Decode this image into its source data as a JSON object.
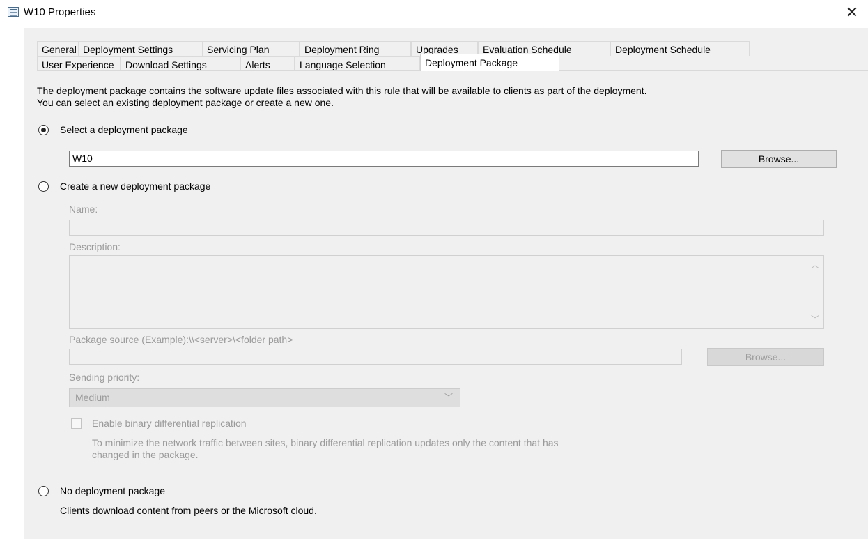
{
  "window": {
    "title": "W10 Properties",
    "close_glyph": "✕",
    "app_icon": "properties-window-icon"
  },
  "tabs_row1": [
    "General",
    "Deployment Settings",
    "Servicing Plan",
    "Deployment Ring",
    "Upgrades",
    "Evaluation Schedule",
    "Deployment Schedule"
  ],
  "tabs_row2": [
    "User Experience",
    "Download Settings",
    "Alerts",
    "Language Selection",
    "Deployment Package"
  ],
  "active_tab": "Deployment Package",
  "description": {
    "line1": "The deployment package contains the software update files associated with this rule that will be available to clients as part of the deployment.",
    "line2": "You can select an existing deployment package or create a new one."
  },
  "options": {
    "select_existing": {
      "label": "Select a deployment package",
      "checked": true,
      "value": "W10",
      "browse_label": "Browse..."
    },
    "create_new": {
      "label": "Create a new deployment package",
      "checked": false,
      "name_label": "Name:",
      "name_value": "",
      "description_label": "Description:",
      "description_value": "",
      "source_label": "Package source (Example):\\\\<server>\\<folder path>",
      "source_value": "",
      "browse_label": "Browse...",
      "priority_label": "Sending priority:",
      "priority_value": "Medium",
      "bdr_label": "Enable binary differential replication",
      "bdr_note_line1": "To minimize the network traffic between sites, binary differential replication updates only the content that has",
      "bdr_note_line2": "changed in the package."
    },
    "none": {
      "label": "No deployment package",
      "checked": false,
      "note": "Clients download content from peers or the Microsoft cloud."
    }
  },
  "colors": {
    "panel_bg": "#f0f0f0",
    "disabled_text": "#9a9a9a"
  }
}
